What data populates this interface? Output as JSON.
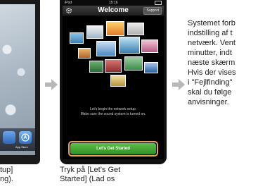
{
  "left_panel": {
    "dock_label": "App Store",
    "caption_lines": [
      "tup]",
      "ng)."
    ]
  },
  "main_panel": {
    "status": {
      "carrier": "iPod",
      "time": "15:16"
    },
    "nav": {
      "title": "Welcome",
      "support_label": "Support"
    },
    "setup_lines": [
      "Let's begin the network setup.",
      "Make sure the sound system is turned on."
    ],
    "start_button_label": "Let's Get Started",
    "caption_lines": [
      "Tryk på [Let’s Get",
      "Started] (Lad os"
    ]
  },
  "instruction_lines": [
    "Systemet forb",
    "indstilling af t",
    "netværk. Vent",
    "minutter, indt",
    "næste skærm",
    "Hvis der vises",
    "i \"Fejlfinding\"",
    "skal du følge",
    "anvisninger."
  ],
  "colors": {
    "arrow": "#b8b8b8",
    "highlight_frame": "#e6a160",
    "start_button": "#3fa333"
  }
}
